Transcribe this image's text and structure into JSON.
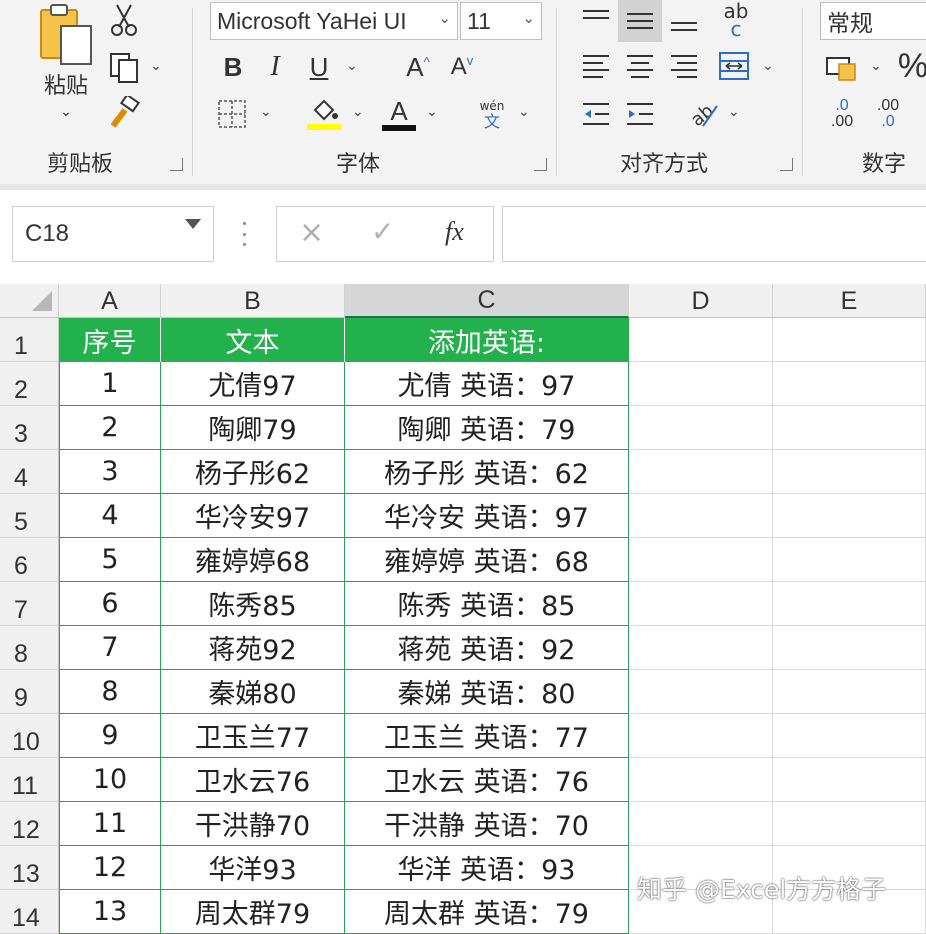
{
  "ribbon": {
    "groups": {
      "clipboard": "剪贴板",
      "font": "字体",
      "alignment": "对齐方式",
      "number": "数字"
    },
    "paste_label": "粘贴",
    "font_name": "Microsoft YaHei UI",
    "font_size": "11",
    "number_format": "常规",
    "font_color": "#cc0000",
    "fill_color": "#ffff00",
    "phonetic_top": "wén",
    "phonetic_bottom": "文",
    "wrap_ab": "ab",
    "wrap_c": "c",
    "dec_increase_top": ".0",
    "dec_increase_bottom": ".00",
    "dec_decrease_top": ".00",
    "dec_decrease_bottom": ".0"
  },
  "formula_bar": {
    "name_box": "C18",
    "cancel_icon": "×",
    "enter_icon": "✓",
    "fx_label": "fx",
    "formula": ""
  },
  "sheet": {
    "columns": [
      "A",
      "B",
      "C",
      "D",
      "E"
    ],
    "selected_column": "C",
    "header_color": "#22b14c",
    "border_color": "#2a9f5e",
    "header_row": [
      "序号",
      "文本",
      "添加英语:"
    ],
    "rows": [
      [
        "1",
        "尤倩97",
        "尤倩 英语：97"
      ],
      [
        "2",
        "陶卿79",
        "陶卿 英语：79"
      ],
      [
        "3",
        "杨子彤62",
        "杨子彤 英语：62"
      ],
      [
        "4",
        "华冷安97",
        "华冷安 英语：97"
      ],
      [
        "5",
        "雍婷婷68",
        "雍婷婷 英语：68"
      ],
      [
        "6",
        "陈秀85",
        "陈秀 英语：85"
      ],
      [
        "7",
        "蒋苑92",
        "蒋苑 英语：92"
      ],
      [
        "8",
        "秦娣80",
        "秦娣 英语：80"
      ],
      [
        "9",
        "卫玉兰77",
        "卫玉兰 英语：77"
      ],
      [
        "10",
        "卫水云76",
        "卫水云 英语：76"
      ],
      [
        "11",
        "干洪静70",
        "干洪静 英语：70"
      ],
      [
        "12",
        "华洋93",
        "华洋 英语：93"
      ],
      [
        "13",
        "周太群79",
        "周太群 英语：79"
      ]
    ],
    "row_numbers": [
      "1",
      "2",
      "3",
      "4",
      "5",
      "6",
      "7",
      "8",
      "9",
      "10",
      "11",
      "12",
      "13",
      "14"
    ]
  },
  "watermark": "知乎 @Excel方方格子"
}
